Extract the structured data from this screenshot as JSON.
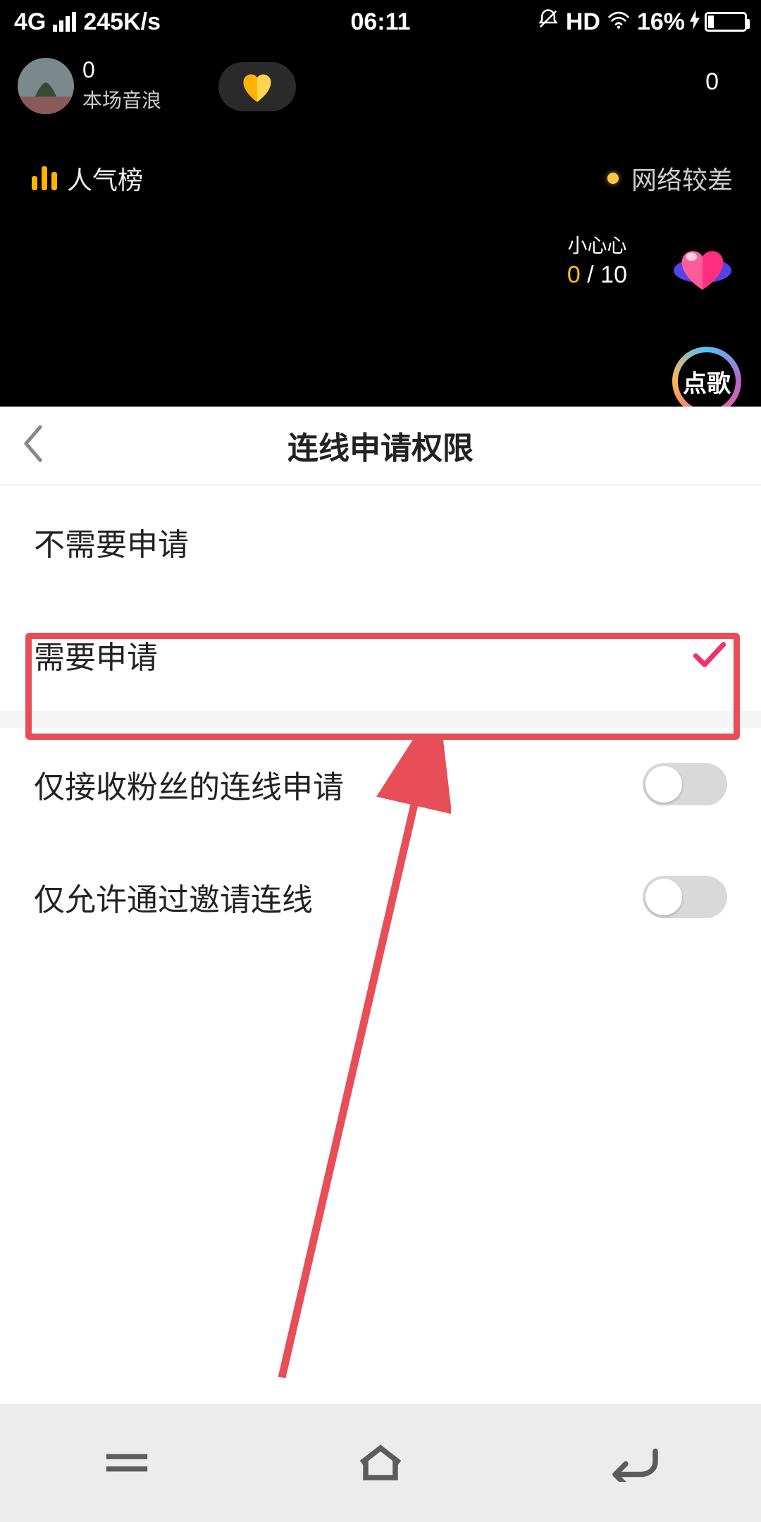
{
  "status": {
    "network_type": "4G",
    "speed": "245K/s",
    "time": "06:11",
    "hd_label": "HD",
    "battery_percent": "16%"
  },
  "live": {
    "score": "0",
    "score_label": "本场音浪",
    "right_count": "0",
    "popularity_label": "人气榜",
    "network_status": "网络较差",
    "mini_heart_title": "小心心",
    "mini_heart_current": "0",
    "mini_heart_sep_total": " / 10",
    "song_button": "点歌"
  },
  "sheet": {
    "title": "连线申请权限",
    "options": [
      {
        "label": "不需要申请",
        "selected": false
      },
      {
        "label": "需要申请",
        "selected": true
      }
    ],
    "toggles": [
      {
        "label": "仅接收粉丝的连线申请",
        "on": false
      },
      {
        "label": "仅允许通过邀请连线",
        "on": false
      }
    ]
  },
  "colors": {
    "highlight": "#E84E58",
    "check": "#F0326E",
    "accent_yellow": "#FFC107"
  }
}
